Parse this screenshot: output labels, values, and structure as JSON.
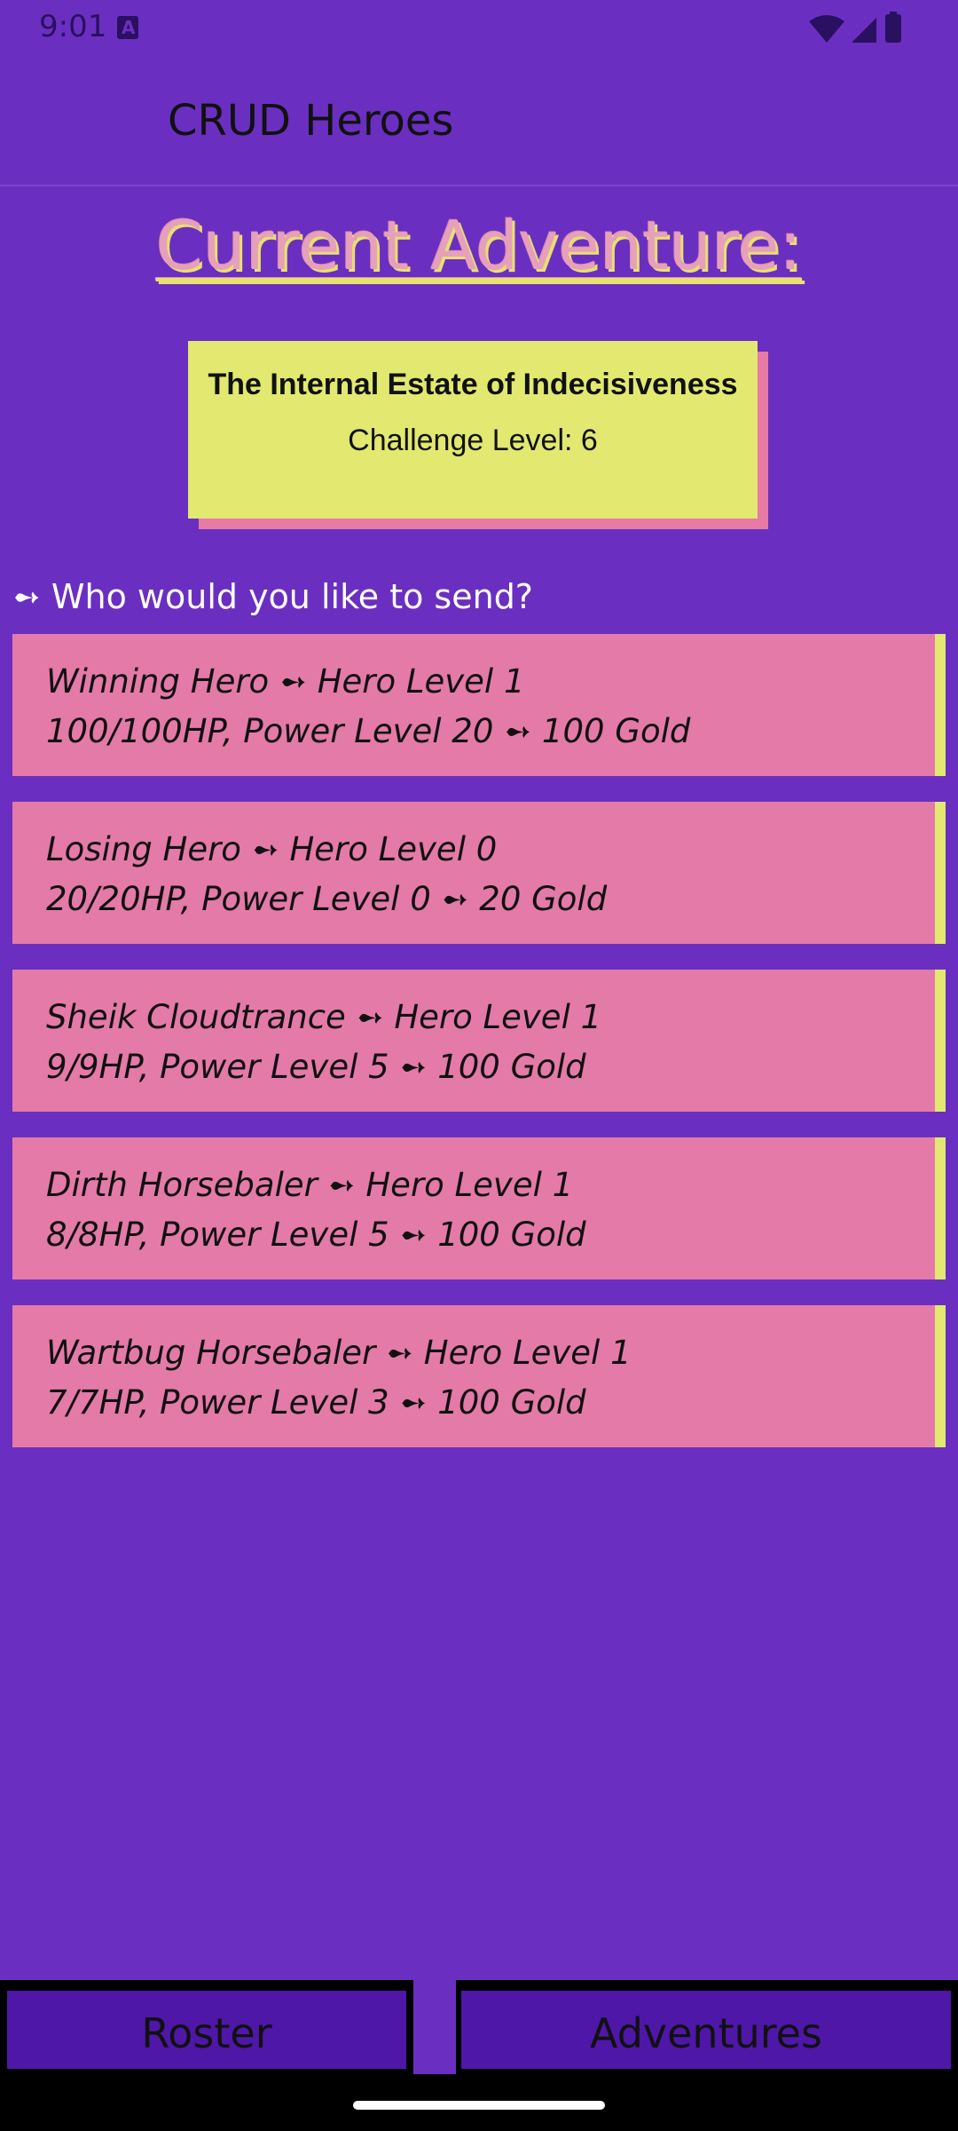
{
  "status_bar": {
    "time": "9:01"
  },
  "app": {
    "title": "CRUD Heroes"
  },
  "adventure": {
    "heading": "Current Adventure:",
    "name": "The Internal Estate of Indecisiveness",
    "challenge": "Challenge Level: 6"
  },
  "prompt": "➻ Who would you like to send?",
  "heroes": [
    {
      "line1": "Winning Hero ➻ Hero Level 1",
      "line2": "100/100HP, Power Level 20 ➻ 100 Gold"
    },
    {
      "line1": "Losing Hero ➻ Hero Level 0",
      "line2": "20/20HP, Power Level 0 ➻ 20 Gold"
    },
    {
      "line1": "Sheik Cloudtrance ➻ Hero Level 1",
      "line2": "9/9HP, Power Level 5 ➻ 100 Gold"
    },
    {
      "line1": "Dirth Horsebaler ➻ Hero Level 1",
      "line2": "8/8HP, Power Level 5 ➻ 100 Gold"
    },
    {
      "line1": "Wartbug Horsebaler ➻ Hero Level 1",
      "line2": "7/7HP, Power Level 3 ➻ 100 Gold"
    }
  ],
  "nav": {
    "roster": "Roster",
    "adventures": "Adventures"
  },
  "colors": {
    "background": "#6a2fc0",
    "card_yellow": "#e2e870",
    "card_pink": "#e47aa8",
    "nav_button": "#4e17a8"
  }
}
